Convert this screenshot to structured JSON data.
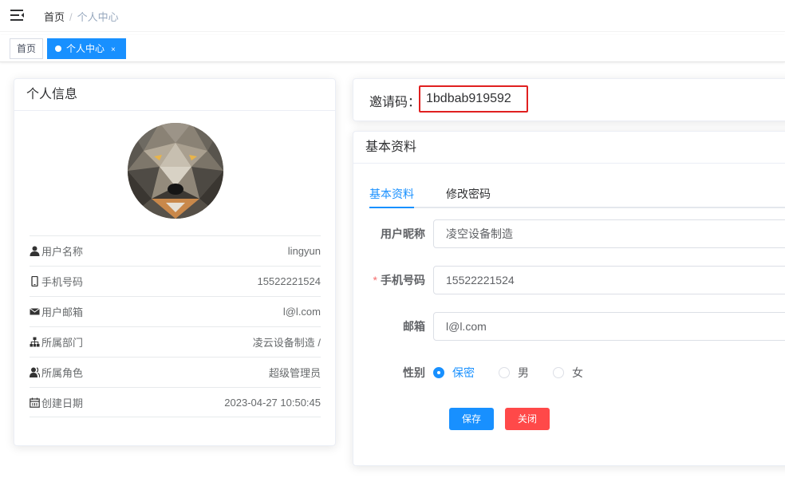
{
  "navbar": {
    "breadcrumb": {
      "home": "首页",
      "separator": "/",
      "current": "个人中心"
    }
  },
  "tags": {
    "home": "首页",
    "active": "个人中心",
    "close": "×"
  },
  "profile_card": {
    "title": "个人信息",
    "items": [
      {
        "label": "用户名称",
        "value": "lingyun",
        "icon": "user-icon"
      },
      {
        "label": "手机号码",
        "value": "15522221524",
        "icon": "phone-icon"
      },
      {
        "label": "用户邮箱",
        "value": "l@l.com",
        "icon": "mail-icon"
      },
      {
        "label": "所属部门",
        "value": "凌云设备制造 /",
        "icon": "tree-icon"
      },
      {
        "label": "所属角色",
        "value": "超级管理员",
        "icon": "peoples-icon"
      },
      {
        "label": "创建日期",
        "value": "2023-04-27 10:50:45",
        "icon": "date-icon"
      }
    ]
  },
  "invite": {
    "label": "邀请码：",
    "code": "1bdbab919592"
  },
  "basic_card": {
    "title": "基本资料",
    "tabs": [
      {
        "label": "基本资料",
        "active": true
      },
      {
        "label": "修改密码",
        "active": false
      }
    ],
    "form": {
      "nickname_label": "用户昵称",
      "nickname_value": "凌空设备制造",
      "phone_required": "*",
      "phone_label": "手机号码",
      "phone_value": "15522221524",
      "email_label": "邮箱",
      "email_value": "l@l.com",
      "gender_label": "性别",
      "gender_options": [
        {
          "label": "保密",
          "checked": true
        },
        {
          "label": "男",
          "checked": false
        },
        {
          "label": "女",
          "checked": false
        }
      ],
      "save_label": "保存",
      "close_label": "关闭"
    }
  },
  "colors": {
    "primary": "#1890ff",
    "danger": "#ff4949",
    "highlight_border": "#e02020"
  }
}
